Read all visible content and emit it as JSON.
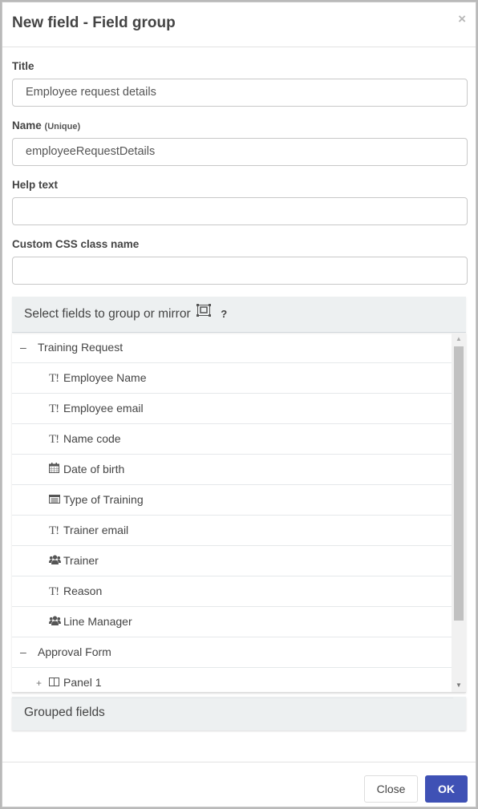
{
  "dialog": {
    "title": "New field - Field group",
    "close_icon": "×"
  },
  "form": {
    "title_label": "Title",
    "title_value": "Employee request details",
    "name_label": "Name",
    "name_hint": "(Unique)",
    "name_value": "employeeRequestDetails",
    "help_label": "Help text",
    "help_value": "",
    "css_label": "Custom CSS class name",
    "css_value": ""
  },
  "select_panel": {
    "heading": "Select fields to group or mirror",
    "mirror_icon": "mirror-icon",
    "help": "?",
    "tree": [
      {
        "kind": "group",
        "toggle": "–",
        "label": "Training Request"
      },
      {
        "kind": "field",
        "icon": "text-field-icon",
        "glyph": "T!",
        "label": "Employee Name"
      },
      {
        "kind": "field",
        "icon": "text-field-icon",
        "glyph": "T!",
        "label": "Employee email"
      },
      {
        "kind": "field",
        "icon": "text-field-icon",
        "glyph": "T!",
        "label": "Name code"
      },
      {
        "kind": "field",
        "icon": "calendar-icon",
        "glyph": "📅",
        "label": "Date of birth"
      },
      {
        "kind": "field",
        "icon": "dropdown-list-icon",
        "glyph": "▤",
        "label": "Type of Training"
      },
      {
        "kind": "field",
        "icon": "text-field-icon",
        "glyph": "T!",
        "label": "Trainer email"
      },
      {
        "kind": "field",
        "icon": "users-icon",
        "glyph": "👥",
        "label": "Trainer"
      },
      {
        "kind": "field",
        "icon": "text-field-icon",
        "glyph": "T!",
        "label": "Reason"
      },
      {
        "kind": "field",
        "icon": "users-icon",
        "glyph": "👥",
        "label": "Line Manager"
      },
      {
        "kind": "group",
        "toggle": "–",
        "label": "Approval Form"
      },
      {
        "kind": "sub",
        "toggle": "+",
        "icon": "panel-icon",
        "glyph": "◫",
        "label": "Panel 1"
      }
    ]
  },
  "grouped_panel": {
    "heading": "Grouped fields"
  },
  "footer": {
    "close_label": "Close",
    "ok_label": "OK"
  }
}
